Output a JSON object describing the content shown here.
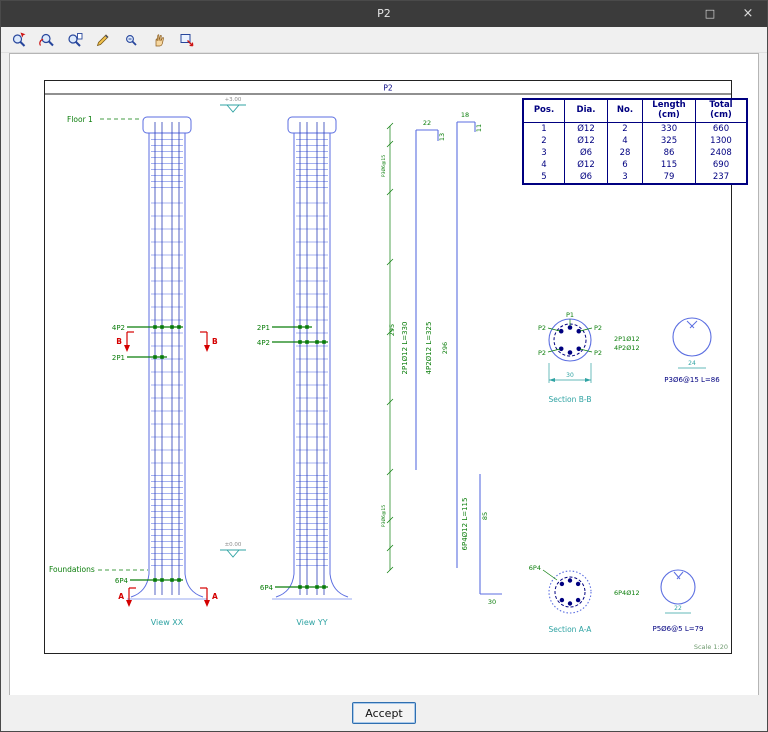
{
  "window": {
    "title": "P2",
    "maximize_glyph": "□",
    "close_glyph": "×"
  },
  "toolbar": {
    "icons": [
      "zoom-window",
      "zoom-extents",
      "zoom-previous",
      "redraw",
      "zoom-realtime",
      "pan",
      "snapshot"
    ]
  },
  "sheet": {
    "title": "P2",
    "scale_note": "Scale 1:20"
  },
  "schedule": {
    "headers": {
      "pos": "Pos.",
      "dia": "Dia.",
      "no": "No.",
      "length": "Length",
      "total": "Total",
      "unit": "(cm)"
    },
    "rows": [
      [
        "1",
        "Ø12",
        "2",
        "330",
        "660"
      ],
      [
        "2",
        "Ø12",
        "4",
        "325",
        "1300"
      ],
      [
        "3",
        "Ø6",
        "28",
        "86",
        "2408"
      ],
      [
        "4",
        "Ø12",
        "6",
        "115",
        "690"
      ],
      [
        "5",
        "Ø6",
        "3",
        "79",
        "237"
      ]
    ]
  },
  "views": {
    "xx": {
      "caption": "View XX",
      "floor_label": "Floor 1",
      "foundations_label": "Foundations",
      "bars_top": "4P2",
      "bars_mid": "2P1",
      "bars_bottom": "6P4",
      "section_top": "B",
      "section_bottom": "A"
    },
    "yy": {
      "caption": "View YY",
      "bars_top": "2P1",
      "bars_mid": "4P2",
      "bars_bottom": "6P4"
    }
  },
  "levels": {
    "top": "+3.00",
    "bottom": "±0.00"
  },
  "bars": {
    "p1": {
      "label": "2P1Ø12 L=330",
      "straight": "295",
      "hook_top": "22",
      "hook_leg": "13"
    },
    "p2": {
      "label": "4P2Ø12 L=325",
      "straight": "296",
      "hook_top": "18",
      "hook_leg": "11"
    },
    "p4": {
      "label": "6P4Ø12 L=115",
      "straight": "85",
      "foot": "30"
    },
    "zone_top": "P3Ø6@15",
    "zone_bottom": "P3Ø6@15"
  },
  "section_bb": {
    "caption": "Section B-B",
    "p1": "P1",
    "p2": "P2",
    "note1": "2P1Ø12",
    "note2": "4P2Ø12",
    "dim": "30"
  },
  "stirrup_b": {
    "caption": "P3Ø6@15 L=86",
    "dim": "24"
  },
  "section_aa": {
    "caption": "Section A-A",
    "label": "6P4",
    "note": "6P4Ø12"
  },
  "stirrup_a": {
    "caption": "P5Ø6@5 L=79",
    "dim": "22"
  },
  "accept_label": "Accept"
}
